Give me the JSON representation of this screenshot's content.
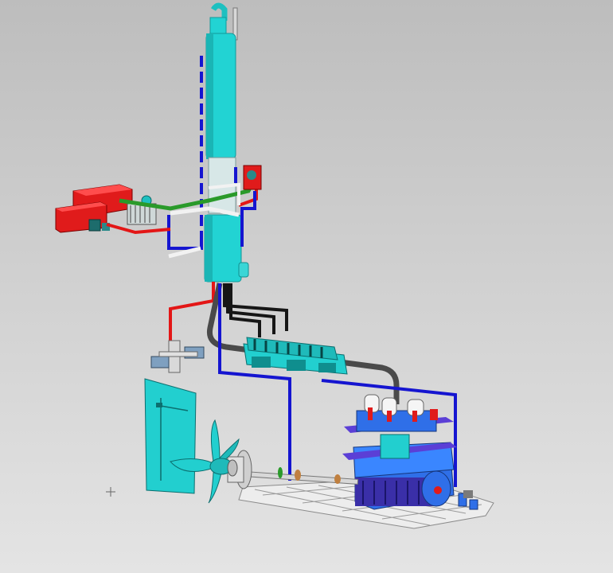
{
  "viewport": {
    "background_top": "#bdbdbd",
    "background_bottom": "#e4e4e4"
  },
  "colors": {
    "cyan_equipment": "#22d3d3",
    "cyan_dark": "#14a8a8",
    "red_equipment": "#e01b1b",
    "pipe_blue": "#1515d0",
    "pipe_red": "#e31616",
    "pipe_white": "#f2f2f2",
    "pipe_green": "#2a9a2a",
    "pipe_black": "#161616",
    "pipe_gray": "#4a4a4a",
    "engine_blue": "#2f6fe8",
    "engine_purple": "#5b3fd6",
    "frame_gray": "#e9e9e9"
  },
  "cursor": {
    "symbol": "+"
  }
}
